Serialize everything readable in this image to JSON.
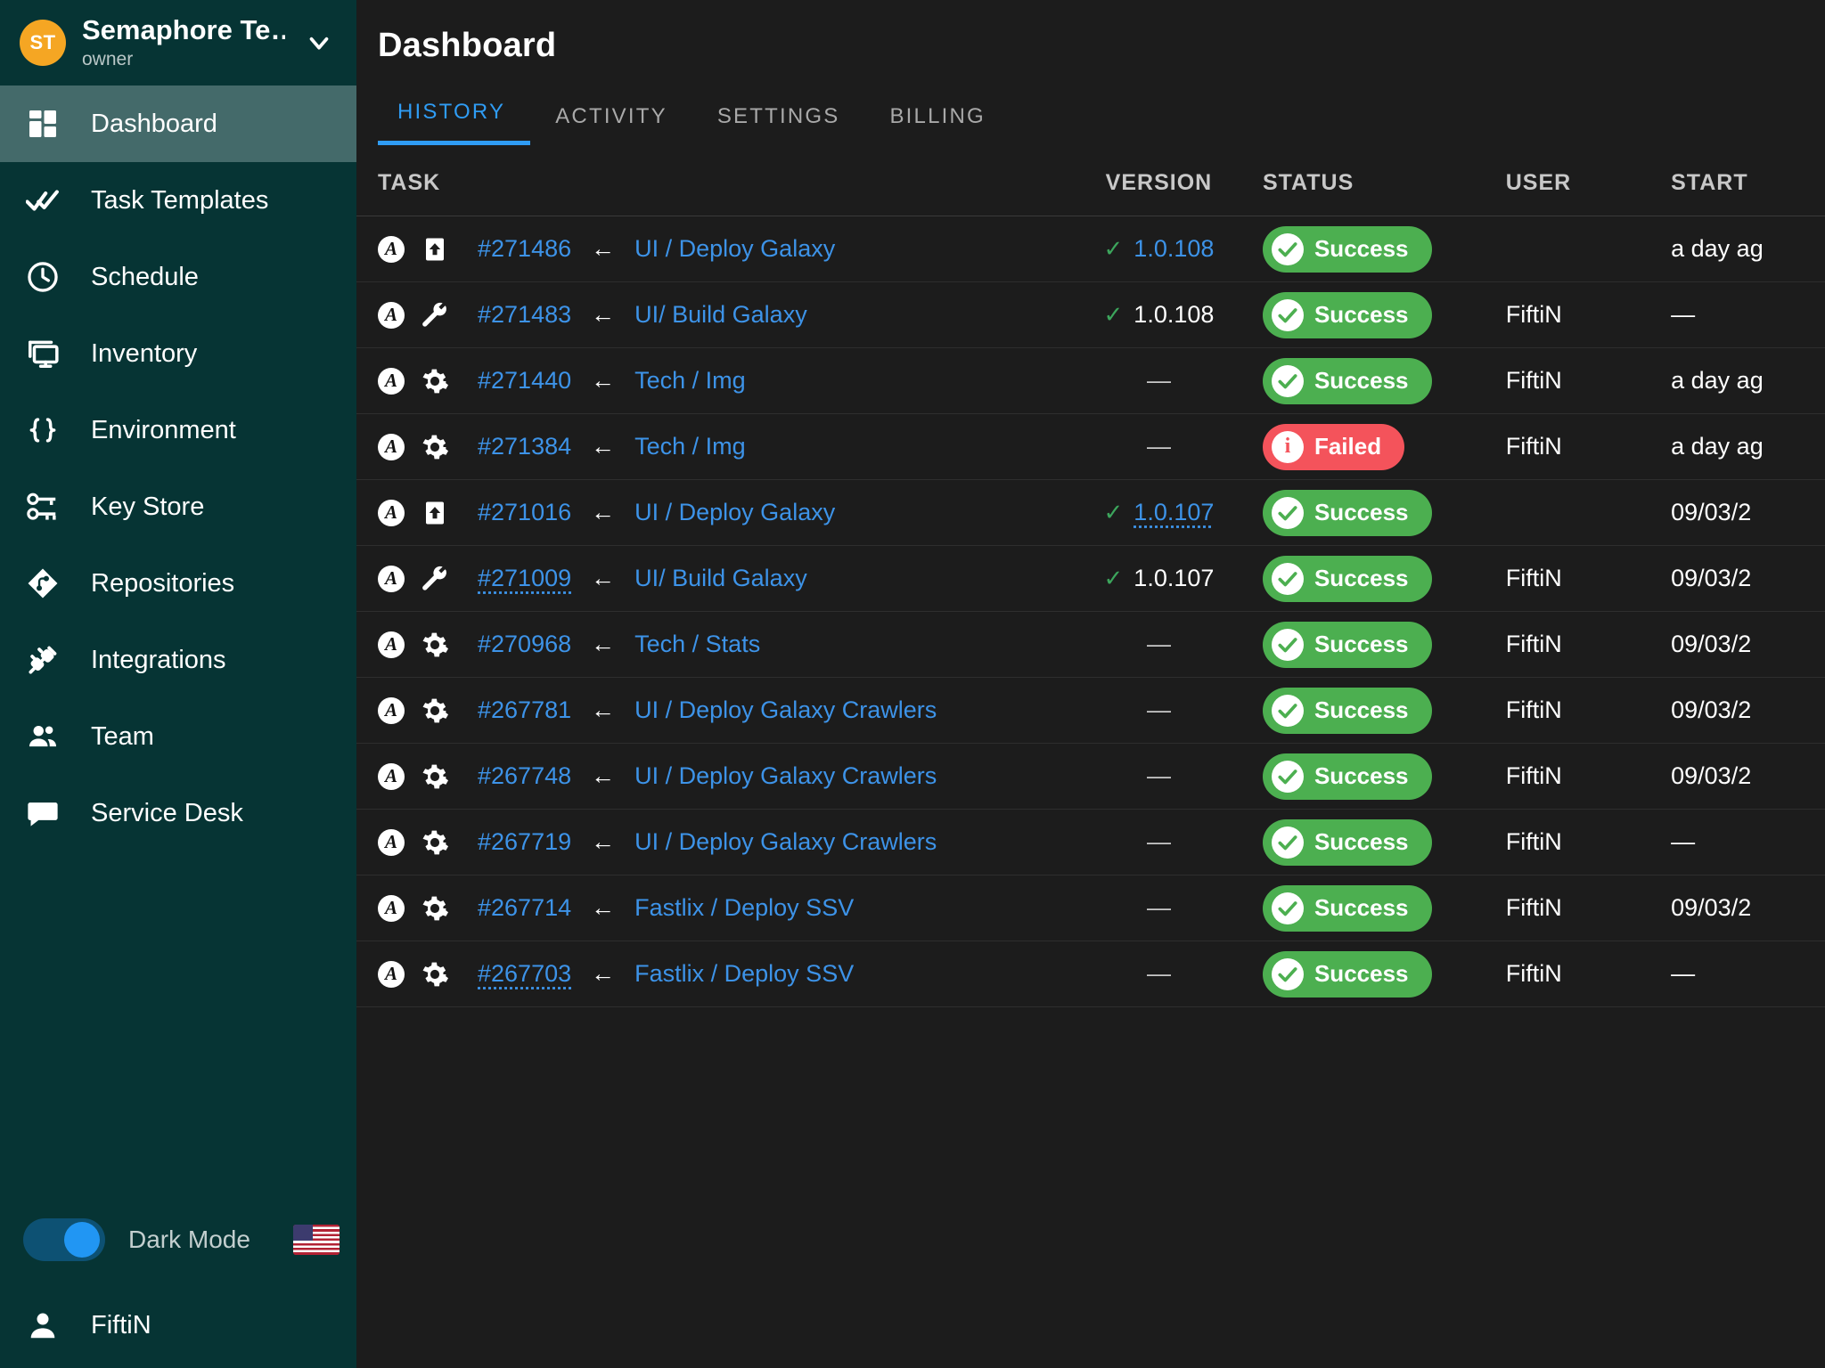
{
  "sidebar": {
    "team": {
      "avatar_initials": "ST",
      "name": "Semaphore Te…",
      "role": "owner",
      "chevron_icon": "chevron-down-icon"
    },
    "items": [
      {
        "label": "Dashboard",
        "icon": "dashboard-grid-icon",
        "active": true
      },
      {
        "label": "Task Templates",
        "icon": "double-check-icon",
        "active": false
      },
      {
        "label": "Schedule",
        "icon": "clock-icon",
        "active": false
      },
      {
        "label": "Inventory",
        "icon": "monitor-icon",
        "active": false
      },
      {
        "label": "Environment",
        "icon": "curly-braces-icon",
        "active": false
      },
      {
        "label": "Key Store",
        "icon": "keys-icon",
        "active": false
      },
      {
        "label": "Repositories",
        "icon": "git-repo-icon",
        "active": false
      },
      {
        "label": "Integrations",
        "icon": "plug-icon",
        "active": false
      },
      {
        "label": "Team",
        "icon": "people-icon",
        "active": false
      },
      {
        "label": "Service Desk",
        "icon": "chat-bubble-icon",
        "active": false
      }
    ],
    "dark_mode": {
      "label": "Dark Mode",
      "enabled": true,
      "flag_icon": "us-flag-icon"
    },
    "user": {
      "name": "FiftiN",
      "icon": "person-icon"
    }
  },
  "main": {
    "title": "Dashboard",
    "tabs": [
      {
        "label": "HISTORY",
        "active": true
      },
      {
        "label": "ACTIVITY",
        "active": false
      },
      {
        "label": "SETTINGS",
        "active": false
      },
      {
        "label": "BILLING",
        "active": false
      }
    ],
    "table": {
      "columns": [
        "TASK",
        "VERSION",
        "STATUS",
        "USER",
        "START"
      ],
      "rows": [
        {
          "runner_icon": "ansible-icon",
          "type_icon": "deploy-upload-icon",
          "id": "#271486",
          "id_dotted": false,
          "arrow": "←",
          "template": "UI / Deploy Galaxy",
          "version": "1.0.108",
          "version_check": true,
          "version_link": true,
          "version_dotted": false,
          "status": "Success",
          "status_kind": "success",
          "user": "",
          "start": "a day ag"
        },
        {
          "runner_icon": "ansible-icon",
          "type_icon": "build-wrench-icon",
          "id": "#271483",
          "id_dotted": false,
          "arrow": "←",
          "template": "UI/ Build Galaxy",
          "version": "1.0.108",
          "version_check": true,
          "version_link": false,
          "version_dotted": false,
          "status": "Success",
          "status_kind": "success",
          "user": "FiftiN",
          "start": "—"
        },
        {
          "runner_icon": "ansible-icon",
          "type_icon": "gear-icon",
          "id": "#271440",
          "id_dotted": false,
          "arrow": "←",
          "template": "Tech / Img",
          "version": "—",
          "version_check": false,
          "version_link": false,
          "version_dotted": false,
          "status": "Success",
          "status_kind": "success",
          "user": "FiftiN",
          "start": "a day ag"
        },
        {
          "runner_icon": "ansible-icon",
          "type_icon": "gear-icon",
          "id": "#271384",
          "id_dotted": false,
          "arrow": "←",
          "template": "Tech / Img",
          "version": "—",
          "version_check": false,
          "version_link": false,
          "version_dotted": false,
          "status": "Failed",
          "status_kind": "failed",
          "user": "FiftiN",
          "start": "a day ag"
        },
        {
          "runner_icon": "ansible-icon",
          "type_icon": "deploy-upload-icon",
          "id": "#271016",
          "id_dotted": false,
          "arrow": "←",
          "template": "UI / Deploy Galaxy",
          "version": "1.0.107",
          "version_check": true,
          "version_link": true,
          "version_dotted": true,
          "status": "Success",
          "status_kind": "success",
          "user": "",
          "start": "09/03/2"
        },
        {
          "runner_icon": "ansible-icon",
          "type_icon": "build-wrench-icon",
          "id": "#271009",
          "id_dotted": true,
          "arrow": "←",
          "template": "UI/ Build Galaxy",
          "version": "1.0.107",
          "version_check": true,
          "version_link": false,
          "version_dotted": false,
          "status": "Success",
          "status_kind": "success",
          "user": "FiftiN",
          "start": "09/03/2"
        },
        {
          "runner_icon": "ansible-icon",
          "type_icon": "gear-icon",
          "id": "#270968",
          "id_dotted": false,
          "arrow": "←",
          "template": "Tech / Stats",
          "version": "—",
          "version_check": false,
          "version_link": false,
          "version_dotted": false,
          "status": "Success",
          "status_kind": "success",
          "user": "FiftiN",
          "start": "09/03/2"
        },
        {
          "runner_icon": "ansible-icon",
          "type_icon": "gear-icon",
          "id": "#267781",
          "id_dotted": false,
          "arrow": "←",
          "template": "UI / Deploy Galaxy Crawlers",
          "version": "—",
          "version_check": false,
          "version_link": false,
          "version_dotted": false,
          "status": "Success",
          "status_kind": "success",
          "user": "FiftiN",
          "start": "09/03/2"
        },
        {
          "runner_icon": "ansible-icon",
          "type_icon": "gear-icon",
          "id": "#267748",
          "id_dotted": false,
          "arrow": "←",
          "template": "UI / Deploy Galaxy Crawlers",
          "version": "—",
          "version_check": false,
          "version_link": false,
          "version_dotted": false,
          "status": "Success",
          "status_kind": "success",
          "user": "FiftiN",
          "start": "09/03/2"
        },
        {
          "runner_icon": "ansible-icon",
          "type_icon": "gear-icon",
          "id": "#267719",
          "id_dotted": false,
          "arrow": "←",
          "template": "UI / Deploy Galaxy Crawlers",
          "version": "—",
          "version_check": false,
          "version_link": false,
          "version_dotted": false,
          "status": "Success",
          "status_kind": "success",
          "user": "FiftiN",
          "start": "—"
        },
        {
          "runner_icon": "ansible-icon",
          "type_icon": "gear-icon",
          "id": "#267714",
          "id_dotted": false,
          "arrow": "←",
          "template": "Fastlix / Deploy SSV",
          "version": "—",
          "version_check": false,
          "version_link": false,
          "version_dotted": false,
          "status": "Success",
          "status_kind": "success",
          "user": "FiftiN",
          "start": "09/03/2"
        },
        {
          "runner_icon": "ansible-icon",
          "type_icon": "gear-icon",
          "id": "#267703",
          "id_dotted": true,
          "arrow": "←",
          "template": "Fastlix / Deploy SSV",
          "version": "—",
          "version_check": false,
          "version_link": false,
          "version_dotted": false,
          "status": "Success",
          "status_kind": "success",
          "user": "FiftiN",
          "start": "—"
        }
      ]
    }
  },
  "colors": {
    "sidebar_bg": "#063434",
    "sidebar_active": "#446a6a",
    "main_bg": "#1c1c1c",
    "accent_blue": "#2f9cf4",
    "link_blue": "#3d93e8",
    "success_green": "#4caf50",
    "failed_red": "#f4535b",
    "avatar_orange": "#f5a623"
  }
}
